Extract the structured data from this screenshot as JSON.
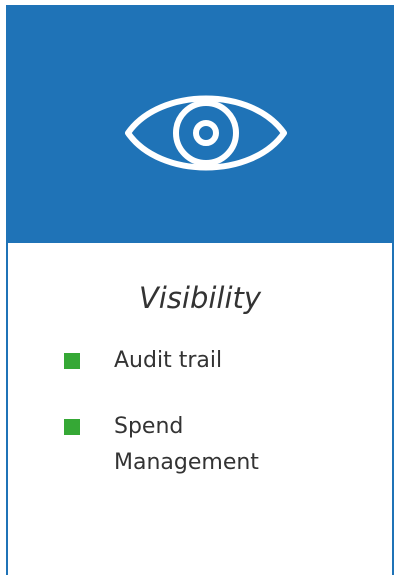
{
  "card": {
    "icon": "eye-icon",
    "title": "Visibility",
    "features": [
      {
        "label": "Audit trail",
        "icon": "bullet-square-icon"
      },
      {
        "label": "Spend Management",
        "icon": "bullet-square-icon"
      }
    ]
  },
  "colors": {
    "header": "#1f73b7",
    "border": "#1f73b7",
    "bullet": "#35a835",
    "text": "#333333",
    "icon_stroke": "#ffffff"
  }
}
